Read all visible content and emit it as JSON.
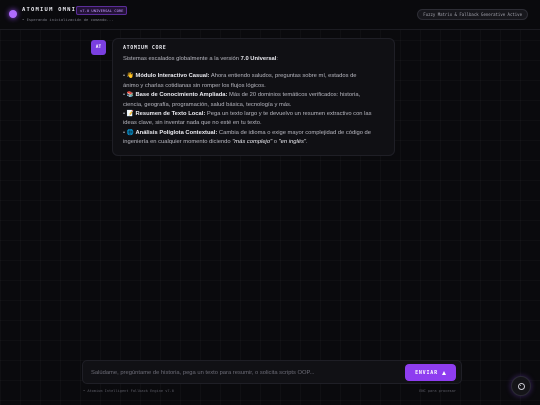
{
  "header": {
    "title": "ATOMIUM OMNI",
    "version_badge": "v7.0 UNIVERSAL CORE",
    "status": "• Esperando inicialización de comando...",
    "pill": "Fuzzy Matrix & Fallback Generative Active"
  },
  "message": {
    "avatar": "AT",
    "sender": "ATOMIUM CORE",
    "intro_before": "Sistemas escalados globalmente a la versión ",
    "intro_version": "7.0 Universal",
    "intro_after": ":",
    "items": [
      {
        "emoji": "👋",
        "title": "Módulo Interactivo Casual:",
        "line1": " Ahora entiendo saludos, preguntas sobre mí, estados de",
        "line2": "ánimo y charlas cotidianas sin romper los flujos lógicos."
      },
      {
        "emoji": "📚",
        "title": "Base de Conocimiento Ampliada:",
        "line1": " Más de 20 dominios temáticos verificados: historia,",
        "line2": "ciencia, geografía, programación, salud básica, tecnología y más."
      },
      {
        "emoji": "📝",
        "title": "Resumen de Texto Local:",
        "line1": " Pega un texto largo y te devuelvo un resumen extractivo con las",
        "line2": "ideas clave, sin inventar nada que no esté en tu texto."
      },
      {
        "emoji": "🌐",
        "title": "Análisis Políglota Contextual:",
        "line1": " Cambia de idioma o exige mayor complejidad de código de",
        "line2_before": "ingeniería en cualquier momento diciendo ",
        "q1": "\"más complejo\"",
        "or": " o ",
        "q2": "\"en inglés\"",
        "end": "."
      }
    ]
  },
  "composer": {
    "placeholder": "Salúdame, pregúntame de historia, pega un texto para resumir, o solicita scripts OOP...",
    "send_label": "ENVIAR"
  },
  "footer": {
    "left": "• Atomium Intelligent Fallback Engine v7.0",
    "right": "ENC para procesar"
  },
  "colors": {
    "accent": "#8e3df0",
    "background": "#0a0a0d"
  }
}
